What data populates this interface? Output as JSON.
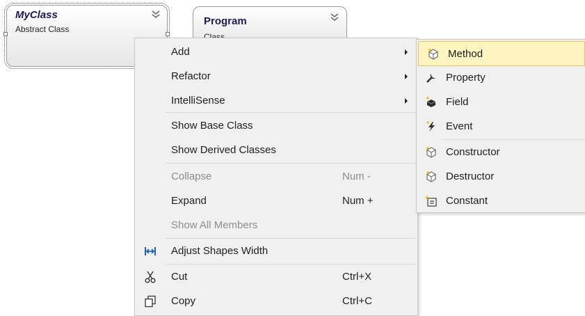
{
  "diagram": {
    "myclass": {
      "title": "MyClass",
      "subtitle": "Abstract Class"
    },
    "program": {
      "title": "Program",
      "subtitle": "Class"
    }
  },
  "context_menu": {
    "items": [
      {
        "label": "Add",
        "shortcut": "",
        "submenu": true
      },
      {
        "label": "Refactor",
        "shortcut": "",
        "submenu": true
      },
      {
        "label": "IntelliSense",
        "shortcut": "",
        "submenu": true
      },
      {
        "label": "Show Base Class",
        "shortcut": ""
      },
      {
        "label": "Show Derived Classes",
        "shortcut": ""
      },
      {
        "label": "Collapse",
        "shortcut": "Num -",
        "disabled": true
      },
      {
        "label": "Expand",
        "shortcut": "Num +"
      },
      {
        "label": "Show All Members",
        "shortcut": "",
        "disabled": true
      },
      {
        "label": "Adjust Shapes Width",
        "shortcut": "",
        "icon": "adjust-width-icon"
      },
      {
        "label": "Cut",
        "shortcut": "Ctrl+X",
        "icon": "scissors-icon"
      },
      {
        "label": "Copy",
        "shortcut": "Ctrl+C",
        "icon": "copy-icon"
      }
    ]
  },
  "add_submenu": {
    "items": [
      {
        "label": "Method",
        "icon": "method-icon"
      },
      {
        "label": "Property",
        "icon": "property-icon"
      },
      {
        "label": "Field",
        "icon": "field-icon"
      },
      {
        "label": "Event",
        "icon": "event-icon"
      },
      {
        "label": "Constructor",
        "icon": "constructor-icon"
      },
      {
        "label": "Destructor",
        "icon": "destructor-icon"
      },
      {
        "label": "Constant",
        "icon": "constant-icon"
      }
    ]
  },
  "colors": {
    "menu_bg": "#f0f0f0",
    "highlight_bg": "#fdf4bf",
    "highlight_border": "#e5c365",
    "disabled_text": "#8d8d8d",
    "title_text": "#1b1b5a"
  }
}
